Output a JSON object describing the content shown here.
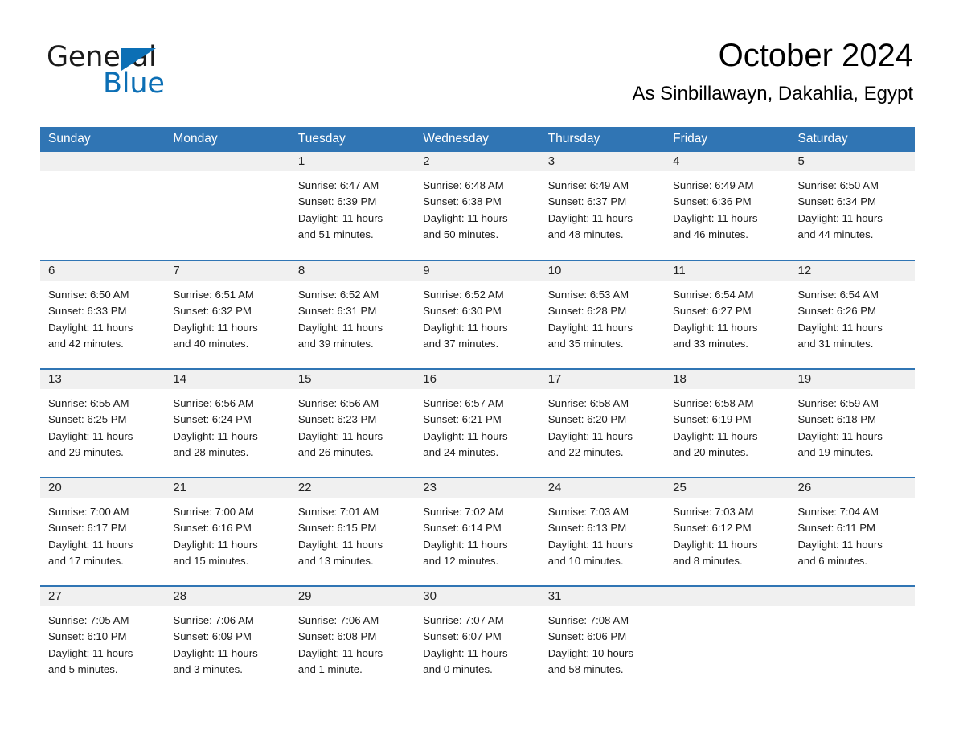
{
  "brand": {
    "name_part1": "General",
    "name_part2": "Blue",
    "triangle_icon": "triangle-logo-icon",
    "accent_color": "#0C6FB5"
  },
  "header": {
    "title": "October 2024",
    "subtitle": "As Sinbillawayn, Dakahlia, Egypt"
  },
  "theme": {
    "header_blue": "#3075B4",
    "daynum_band": "#F0F0F0",
    "text": "#1a1a1a"
  },
  "columns": [
    "Sunday",
    "Monday",
    "Tuesday",
    "Wednesday",
    "Thursday",
    "Friday",
    "Saturday"
  ],
  "weeks": [
    [
      {
        "day": "",
        "empty": true,
        "sunrise": "",
        "sunset": "",
        "daylight1": "",
        "daylight2": ""
      },
      {
        "day": "",
        "empty": true,
        "sunrise": "",
        "sunset": "",
        "daylight1": "",
        "daylight2": ""
      },
      {
        "day": "1",
        "empty": false,
        "sunrise": "Sunrise: 6:47 AM",
        "sunset": "Sunset: 6:39 PM",
        "daylight1": "Daylight: 11 hours",
        "daylight2": "and 51 minutes."
      },
      {
        "day": "2",
        "empty": false,
        "sunrise": "Sunrise: 6:48 AM",
        "sunset": "Sunset: 6:38 PM",
        "daylight1": "Daylight: 11 hours",
        "daylight2": "and 50 minutes."
      },
      {
        "day": "3",
        "empty": false,
        "sunrise": "Sunrise: 6:49 AM",
        "sunset": "Sunset: 6:37 PM",
        "daylight1": "Daylight: 11 hours",
        "daylight2": "and 48 minutes."
      },
      {
        "day": "4",
        "empty": false,
        "sunrise": "Sunrise: 6:49 AM",
        "sunset": "Sunset: 6:36 PM",
        "daylight1": "Daylight: 11 hours",
        "daylight2": "and 46 minutes."
      },
      {
        "day": "5",
        "empty": false,
        "sunrise": "Sunrise: 6:50 AM",
        "sunset": "Sunset: 6:34 PM",
        "daylight1": "Daylight: 11 hours",
        "daylight2": "and 44 minutes."
      }
    ],
    [
      {
        "day": "6",
        "empty": false,
        "sunrise": "Sunrise: 6:50 AM",
        "sunset": "Sunset: 6:33 PM",
        "daylight1": "Daylight: 11 hours",
        "daylight2": "and 42 minutes."
      },
      {
        "day": "7",
        "empty": false,
        "sunrise": "Sunrise: 6:51 AM",
        "sunset": "Sunset: 6:32 PM",
        "daylight1": "Daylight: 11 hours",
        "daylight2": "and 40 minutes."
      },
      {
        "day": "8",
        "empty": false,
        "sunrise": "Sunrise: 6:52 AM",
        "sunset": "Sunset: 6:31 PM",
        "daylight1": "Daylight: 11 hours",
        "daylight2": "and 39 minutes."
      },
      {
        "day": "9",
        "empty": false,
        "sunrise": "Sunrise: 6:52 AM",
        "sunset": "Sunset: 6:30 PM",
        "daylight1": "Daylight: 11 hours",
        "daylight2": "and 37 minutes."
      },
      {
        "day": "10",
        "empty": false,
        "sunrise": "Sunrise: 6:53 AM",
        "sunset": "Sunset: 6:28 PM",
        "daylight1": "Daylight: 11 hours",
        "daylight2": "and 35 minutes."
      },
      {
        "day": "11",
        "empty": false,
        "sunrise": "Sunrise: 6:54 AM",
        "sunset": "Sunset: 6:27 PM",
        "daylight1": "Daylight: 11 hours",
        "daylight2": "and 33 minutes."
      },
      {
        "day": "12",
        "empty": false,
        "sunrise": "Sunrise: 6:54 AM",
        "sunset": "Sunset: 6:26 PM",
        "daylight1": "Daylight: 11 hours",
        "daylight2": "and 31 minutes."
      }
    ],
    [
      {
        "day": "13",
        "empty": false,
        "sunrise": "Sunrise: 6:55 AM",
        "sunset": "Sunset: 6:25 PM",
        "daylight1": "Daylight: 11 hours",
        "daylight2": "and 29 minutes."
      },
      {
        "day": "14",
        "empty": false,
        "sunrise": "Sunrise: 6:56 AM",
        "sunset": "Sunset: 6:24 PM",
        "daylight1": "Daylight: 11 hours",
        "daylight2": "and 28 minutes."
      },
      {
        "day": "15",
        "empty": false,
        "sunrise": "Sunrise: 6:56 AM",
        "sunset": "Sunset: 6:23 PM",
        "daylight1": "Daylight: 11 hours",
        "daylight2": "and 26 minutes."
      },
      {
        "day": "16",
        "empty": false,
        "sunrise": "Sunrise: 6:57 AM",
        "sunset": "Sunset: 6:21 PM",
        "daylight1": "Daylight: 11 hours",
        "daylight2": "and 24 minutes."
      },
      {
        "day": "17",
        "empty": false,
        "sunrise": "Sunrise: 6:58 AM",
        "sunset": "Sunset: 6:20 PM",
        "daylight1": "Daylight: 11 hours",
        "daylight2": "and 22 minutes."
      },
      {
        "day": "18",
        "empty": false,
        "sunrise": "Sunrise: 6:58 AM",
        "sunset": "Sunset: 6:19 PM",
        "daylight1": "Daylight: 11 hours",
        "daylight2": "and 20 minutes."
      },
      {
        "day": "19",
        "empty": false,
        "sunrise": "Sunrise: 6:59 AM",
        "sunset": "Sunset: 6:18 PM",
        "daylight1": "Daylight: 11 hours",
        "daylight2": "and 19 minutes."
      }
    ],
    [
      {
        "day": "20",
        "empty": false,
        "sunrise": "Sunrise: 7:00 AM",
        "sunset": "Sunset: 6:17 PM",
        "daylight1": "Daylight: 11 hours",
        "daylight2": "and 17 minutes."
      },
      {
        "day": "21",
        "empty": false,
        "sunrise": "Sunrise: 7:00 AM",
        "sunset": "Sunset: 6:16 PM",
        "daylight1": "Daylight: 11 hours",
        "daylight2": "and 15 minutes."
      },
      {
        "day": "22",
        "empty": false,
        "sunrise": "Sunrise: 7:01 AM",
        "sunset": "Sunset: 6:15 PM",
        "daylight1": "Daylight: 11 hours",
        "daylight2": "and 13 minutes."
      },
      {
        "day": "23",
        "empty": false,
        "sunrise": "Sunrise: 7:02 AM",
        "sunset": "Sunset: 6:14 PM",
        "daylight1": "Daylight: 11 hours",
        "daylight2": "and 12 minutes."
      },
      {
        "day": "24",
        "empty": false,
        "sunrise": "Sunrise: 7:03 AM",
        "sunset": "Sunset: 6:13 PM",
        "daylight1": "Daylight: 11 hours",
        "daylight2": "and 10 minutes."
      },
      {
        "day": "25",
        "empty": false,
        "sunrise": "Sunrise: 7:03 AM",
        "sunset": "Sunset: 6:12 PM",
        "daylight1": "Daylight: 11 hours",
        "daylight2": "and 8 minutes."
      },
      {
        "day": "26",
        "empty": false,
        "sunrise": "Sunrise: 7:04 AM",
        "sunset": "Sunset: 6:11 PM",
        "daylight1": "Daylight: 11 hours",
        "daylight2": "and 6 minutes."
      }
    ],
    [
      {
        "day": "27",
        "empty": false,
        "sunrise": "Sunrise: 7:05 AM",
        "sunset": "Sunset: 6:10 PM",
        "daylight1": "Daylight: 11 hours",
        "daylight2": "and 5 minutes."
      },
      {
        "day": "28",
        "empty": false,
        "sunrise": "Sunrise: 7:06 AM",
        "sunset": "Sunset: 6:09 PM",
        "daylight1": "Daylight: 11 hours",
        "daylight2": "and 3 minutes."
      },
      {
        "day": "29",
        "empty": false,
        "sunrise": "Sunrise: 7:06 AM",
        "sunset": "Sunset: 6:08 PM",
        "daylight1": "Daylight: 11 hours",
        "daylight2": "and 1 minute."
      },
      {
        "day": "30",
        "empty": false,
        "sunrise": "Sunrise: 7:07 AM",
        "sunset": "Sunset: 6:07 PM",
        "daylight1": "Daylight: 11 hours",
        "daylight2": "and 0 minutes."
      },
      {
        "day": "31",
        "empty": false,
        "sunrise": "Sunrise: 7:08 AM",
        "sunset": "Sunset: 6:06 PM",
        "daylight1": "Daylight: 10 hours",
        "daylight2": "and 58 minutes."
      },
      {
        "day": "",
        "empty": true,
        "sunrise": "",
        "sunset": "",
        "daylight1": "",
        "daylight2": ""
      },
      {
        "day": "",
        "empty": true,
        "sunrise": "",
        "sunset": "",
        "daylight1": "",
        "daylight2": ""
      }
    ]
  ]
}
